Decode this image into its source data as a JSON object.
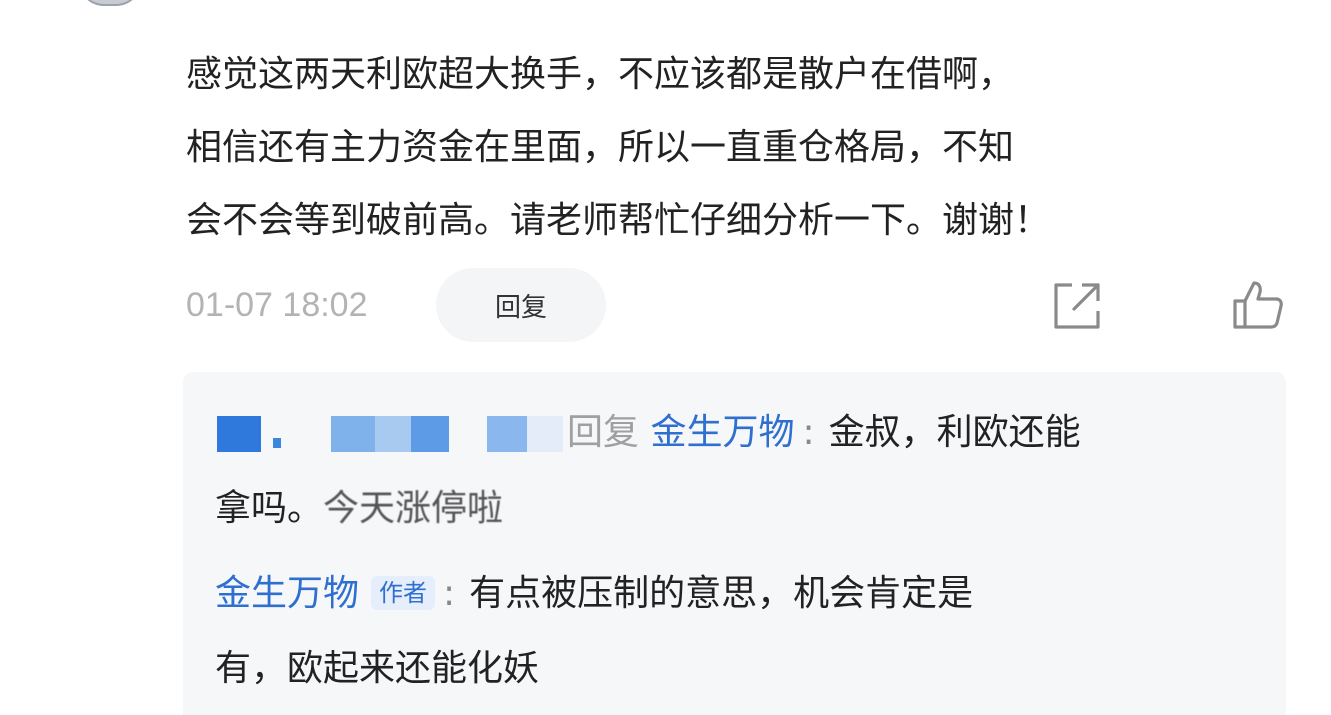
{
  "comment": {
    "username": "",
    "lines": [
      "感觉这两天利欧超大换手，不应该都是散户在借啊，",
      "相信还有主力资金在里面，所以一直重仓格局，不知",
      "会不会等到破前高。请老师帮忙仔细分析一下。谢谢！"
    ],
    "timestamp": "01-07 18:02",
    "reply_label": "回复",
    "share_icon": "share-icon",
    "like_icon": "thumbs-up-icon"
  },
  "replies": {
    "first": {
      "reply_word": "回复",
      "target_name": "金生万物",
      "line1": "金叔，利欧还能",
      "line2_a": "拿吗。",
      "line2_b": "今天涨停啦"
    },
    "second": {
      "author_name": "金生万物",
      "badge": "作者",
      "line1": "有点被压制的意思，机会肯定是",
      "line2": "有，欧起来还能化妖"
    }
  },
  "colors": {
    "accent_blue": "#2f6fd0",
    "muted_gray": "#b3b3b3",
    "reply_bg": "#f6f7f9"
  }
}
